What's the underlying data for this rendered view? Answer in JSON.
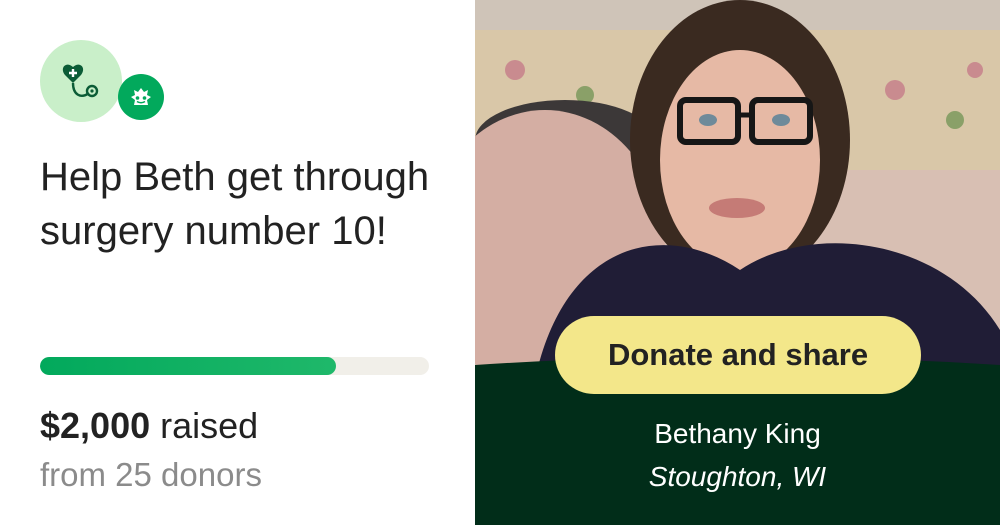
{
  "fundraiser": {
    "title": "Help Beth get through surgery number 10!",
    "category_icon": "heart-stethoscope-icon",
    "status_icon": "gofundme-smile-icon",
    "progress_fraction": 0.76,
    "raised_amount": "$2,000",
    "raised_label": " raised",
    "donors_text": "from 25 donors"
  },
  "cta": {
    "donate_label": "Donate and share"
  },
  "organizer": {
    "name": "Bethany King",
    "location": "Stoughton, WI"
  },
  "colors": {
    "brand_green": "#02a95c",
    "light_green": "#c9efc9",
    "dark_green": "#012d19",
    "button_yellow": "#f3e78a"
  }
}
